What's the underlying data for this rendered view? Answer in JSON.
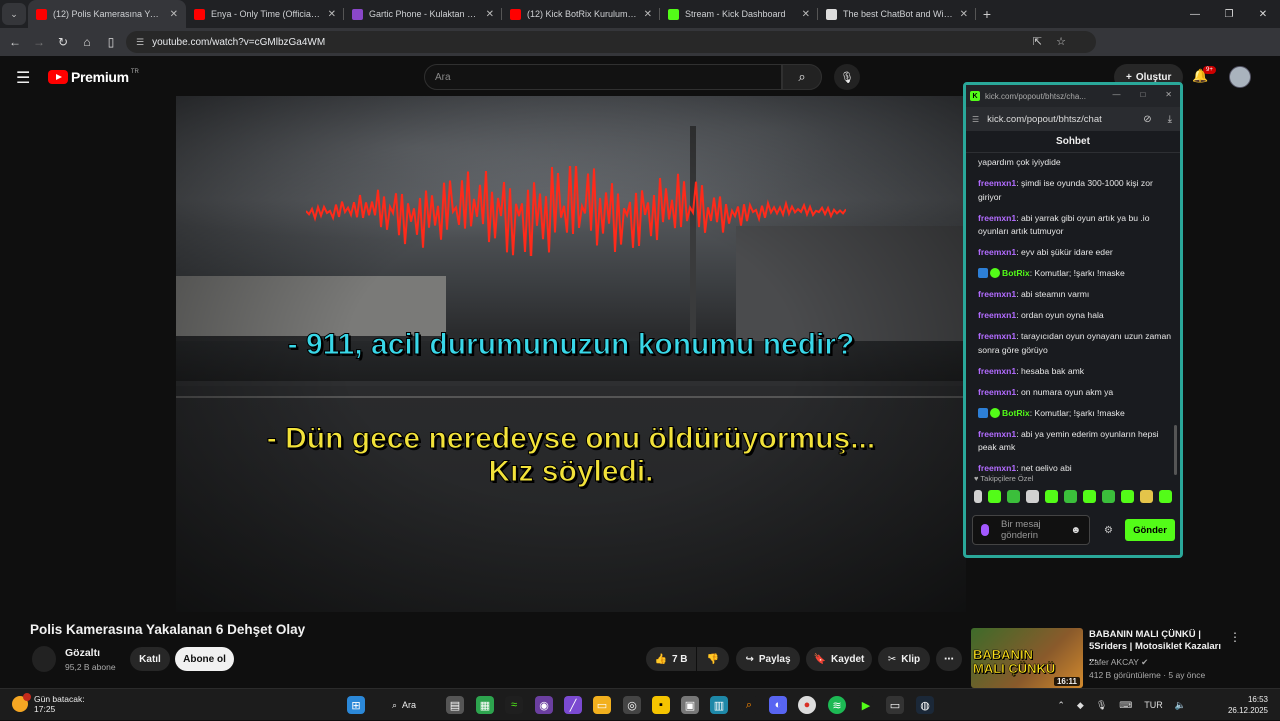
{
  "browser": {
    "tabs": [
      {
        "label": "(12) Polis Kamerasına Yakalanan 6 Dehşet Olay",
        "fav_color": "#ff0000",
        "active": true
      },
      {
        "label": "Enya - Only Time (Official 4K Music Video)",
        "fav_color": "#ff0000",
        "active": false
      },
      {
        "label": "Gartic Phone - Kulaktan Kulağa",
        "fav_color": "#8a47c9",
        "active": false
      },
      {
        "label": "(12) Kick BotRix Kurulum Ayarları",
        "fav_color": "#ff0000",
        "active": false
      },
      {
        "label": "Stream - Kick Dashboard",
        "fav_color": "#53fc18",
        "active": false
      },
      {
        "label": "The best ChatBot and Widgets",
        "fav_color": "#dddddd",
        "active": false
      }
    ],
    "url": "youtube.com/watch?v=cGMlbzGa4WM"
  },
  "youtube": {
    "logo_text": "Premium",
    "logo_sup": "TR",
    "search_placeholder": "Ara",
    "create_label": "Oluştur",
    "notif_badge": "9+"
  },
  "video": {
    "subtitle_1": "- 911, acil durumunuzun konumu nedir?",
    "subtitle_2_line1": "- Dün gece neredeyse onu öldürüyormuş...",
    "subtitle_2_line2": "Kız söyledi.",
    "wave_color": "#ff2a1a"
  },
  "popup": {
    "title_url": "kick.com/popout/bhtsz/cha...",
    "url": "kick.com/popout/bhtsz/chat",
    "chat_title": "Sohbet",
    "messages": [
      {
        "user": "",
        "text": "yapardım çok iyiydide",
        "bot": false
      },
      {
        "user": "freemxn1",
        "text": "şimdi ise oyunda 300-1000 kişi zor giriyor",
        "bot": false
      },
      {
        "user": "freemxn1",
        "text": "abi yarrak gibi oyun artık ya bu .io oyunları artık tutmuyor",
        "bot": false
      },
      {
        "user": "freemxn1",
        "text": "eyv abi şükür idare eder",
        "bot": false
      },
      {
        "user": "BotRix",
        "text": "Komutlar; !şarkı !maske",
        "bot": true
      },
      {
        "user": "freemxn1",
        "text": "abi steamın varmı",
        "bot": false
      },
      {
        "user": "freemxn1",
        "text": "ordan oyun oyna hala",
        "bot": false
      },
      {
        "user": "freemxn1",
        "text": "tarayıcıdan oyun oynayanı uzun zaman sonra göre görüyo",
        "bot": false
      },
      {
        "user": "freemxn1",
        "text": "hesaba bak amk",
        "bot": false
      },
      {
        "user": "freemxn1",
        "text": "on numara oyun akm ya",
        "bot": false
      },
      {
        "user": "BotRix",
        "text": "Komutlar; !şarkı !maske",
        "bot": true
      },
      {
        "user": "freemxn1",
        "text": "abi ya yemin ederim oyunların hepsi peak amk",
        "bot": false
      },
      {
        "user": "freemxn1",
        "text": "net geliyo abi",
        "bot": false
      }
    ],
    "pinned_label": "Takipçilere Özel",
    "input_placeholder_1": "Bir mesaj",
    "input_placeholder_2": "gönderin",
    "send_label": "Gönder",
    "accent": "#53fc18",
    "username_color": "#b26cff"
  },
  "below": {
    "title": "Polis Kamerasına Yakalanan 6 Dehşet Olay",
    "channel": "Gözaltı",
    "subs": "95,2 B abone",
    "join": "Katıl",
    "subscribe": "Abone ol",
    "likes": "7 B",
    "share": "Paylaş",
    "save": "Kaydet",
    "clip": "Klip"
  },
  "recommendation": {
    "thumb_text_1": "BABANIN",
    "thumb_text_2": "MALI ÇÜNKÜ",
    "duration": "16:11",
    "title": "BABANIN MALI ÇÜNKÜ | 5Sriders | Motosiklet Kazaları ...",
    "channel": "Zafer AKCAY",
    "meta": "412 B görüntüleme · 5 ay önce"
  },
  "taskbar": {
    "weather_1": "Gün batacak:",
    "weather_2": "17:25",
    "search_label": "Ara",
    "lang": "TUR",
    "time": "16:53",
    "date": "26.12.2025"
  }
}
